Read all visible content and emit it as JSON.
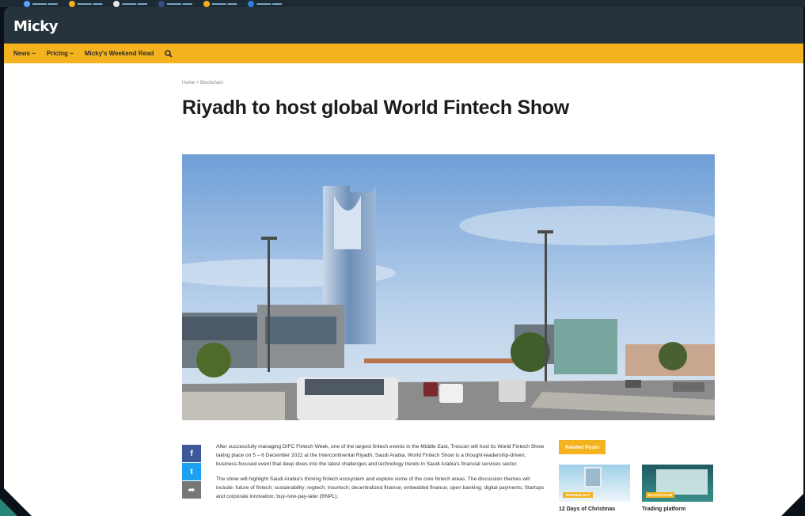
{
  "site": {
    "logo": "Micky"
  },
  "nav": {
    "items": [
      {
        "label": "News ~"
      },
      {
        "label": "Pricing ~"
      },
      {
        "label": "Micky's Weekend Read"
      }
    ]
  },
  "breadcrumb": "Home > Blockchain",
  "article": {
    "title": "Riyadh to host global World Fintech Show",
    "paragraphs": [
      "After successfully managing DIFC Fintech Week, one of the largest fintech events in the Middle East, Trescon will host its World Fintech Show taking place on 5 – 6 December 2022 at the Intercontinental Riyadh, Saudi Arabia. World Fintech Show is a thought-leadership-driven, business-focused event that deep dives into the latest challenges and technology trends in Saudi Arabia's financial services sector.",
      "The show will highlight Saudi Arabia's thriving fintech ecosystem and explore some of the core fintech areas. The discussion themes will include: future of fintech; sustainability; regtech; insurtech; decentralized finance; embedded finance; open banking; digital payments; Startups and corporate innovation; buy-now-pay-later (BNPL);"
    ]
  },
  "share": {
    "facebook": "f",
    "twitter": "t",
    "share": "➦"
  },
  "related": {
    "label": "Related Posts",
    "cards": [
      {
        "badge": "TECHNOLOGY",
        "title": "12 Days of Christmas"
      },
      {
        "badge": "BLOCKCHAIN",
        "title": "Trading platform"
      }
    ]
  },
  "colors": {
    "accent": "#f5b21f",
    "header": "#26333d",
    "facebook": "#3b5998",
    "twitter": "#1da1f2"
  }
}
